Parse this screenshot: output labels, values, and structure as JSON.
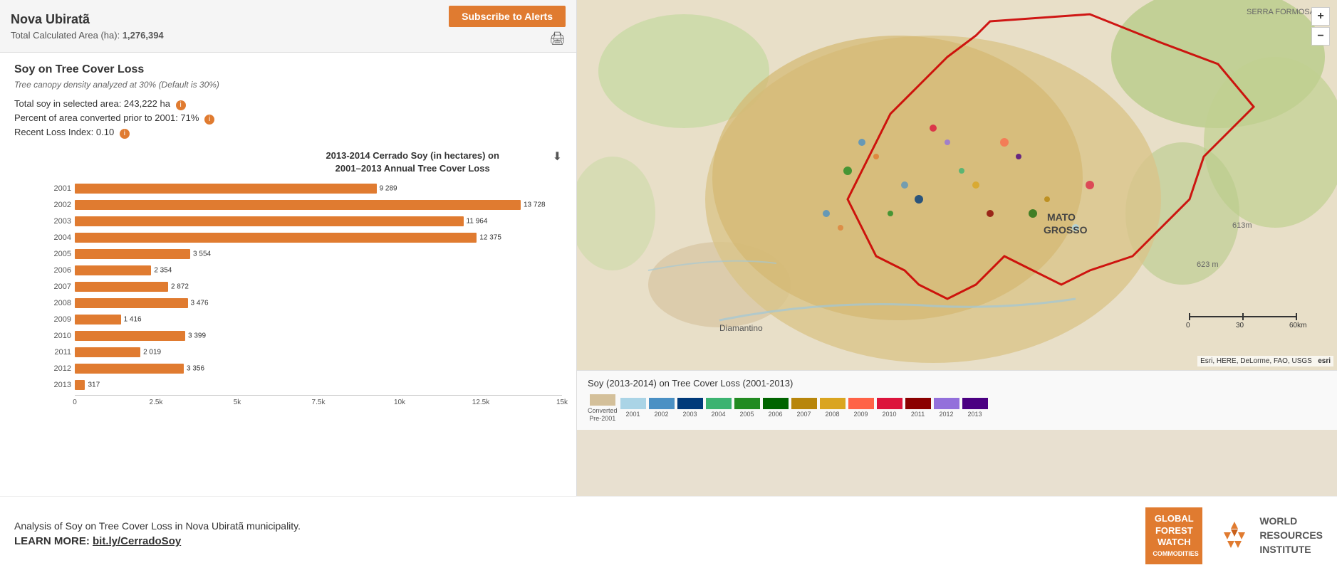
{
  "header": {
    "title": "Nova Ubiratã",
    "area_label": "Total Calculated Area (ha):",
    "area_value": "1,276,394",
    "subscribe_label": "Subscribe to Alerts"
  },
  "chart_section": {
    "main_title": "Soy on Tree Cover Loss",
    "subtitle": "Tree canopy density analyzed at 30% (Default is 30%)",
    "stats": {
      "total_soy": "Total soy in selected area: 243,222 ha",
      "percent_converted": "Percent of area converted prior to 2001: 71%",
      "recent_loss": "Recent Loss Index: 0.10"
    },
    "chart_title_line1": "2013-2014 Cerrado Soy (in hectares) on",
    "chart_title_line2": "2001–2013 Annual Tree Cover Loss",
    "bars": [
      {
        "year": "2001",
        "value": 9289,
        "display": "9 289"
      },
      {
        "year": "2002",
        "value": 13728,
        "display": "13 728"
      },
      {
        "year": "2003",
        "value": 11964,
        "display": "11 964"
      },
      {
        "year": "2004",
        "value": 12375,
        "display": "12 375"
      },
      {
        "year": "2005",
        "value": 3554,
        "display": "3 554"
      },
      {
        "year": "2006",
        "value": 2354,
        "display": "2 354"
      },
      {
        "year": "2007",
        "value": 2872,
        "display": "2 872"
      },
      {
        "year": "2008",
        "value": 3476,
        "display": "3 476"
      },
      {
        "year": "2009",
        "value": 1416,
        "display": "1 416"
      },
      {
        "year": "2010",
        "value": 3399,
        "display": "3 399"
      },
      {
        "year": "2011",
        "value": 2019,
        "display": "2 019"
      },
      {
        "year": "2012",
        "value": 3356,
        "display": "3 356"
      },
      {
        "year": "2013",
        "value": 317,
        "display": "317"
      }
    ],
    "x_axis": [
      "0",
      "2.5k",
      "5k",
      "7.5k",
      "10k",
      "12.5k",
      "15k"
    ],
    "max_value": 15000
  },
  "map": {
    "zoom_in": "+",
    "zoom_out": "−",
    "attribution": "Esri, HERE, DeLorme, FAO, USGS",
    "esri_label": "esri",
    "scale_label": "0    30    60km"
  },
  "legend": {
    "title": "Soy (2013-2014) on Tree Cover Loss (2001-2013)",
    "items": [
      {
        "label": "Converted\nPre-2001",
        "color": "#d4c09a"
      },
      {
        "label": "2001",
        "color": "#aad4e6"
      },
      {
        "label": "2002",
        "color": "#4a90c4"
      },
      {
        "label": "2003",
        "color": "#003a7a"
      },
      {
        "label": "2004",
        "color": "#3cb371"
      },
      {
        "label": "2005",
        "color": "#228b22"
      },
      {
        "label": "2006",
        "color": "#006400"
      },
      {
        "label": "2007",
        "color": "#b8860b"
      },
      {
        "label": "2008",
        "color": "#daa520"
      },
      {
        "label": "2009",
        "color": "#ff6347"
      },
      {
        "label": "2010",
        "color": "#dc143c"
      },
      {
        "label": "2011",
        "color": "#8b0000"
      },
      {
        "label": "2012",
        "color": "#9370db"
      },
      {
        "label": "2013",
        "color": "#4b0082"
      }
    ]
  },
  "bottom": {
    "description": "Analysis of Soy on Tree Cover Loss in Nova Ubiratã municipality.",
    "learn_more_label": "LEARN MORE:",
    "learn_more_link": "bit.ly/CerradoSoy",
    "gfw_line1": "GLOBAL",
    "gfw_line2": "FOREST",
    "gfw_line3": "WATCH",
    "gfw_line4": "COMMODITIES",
    "wri_line1": "WORLD",
    "wri_line2": "RESOURCES",
    "wri_line3": "INSTITUTE"
  }
}
